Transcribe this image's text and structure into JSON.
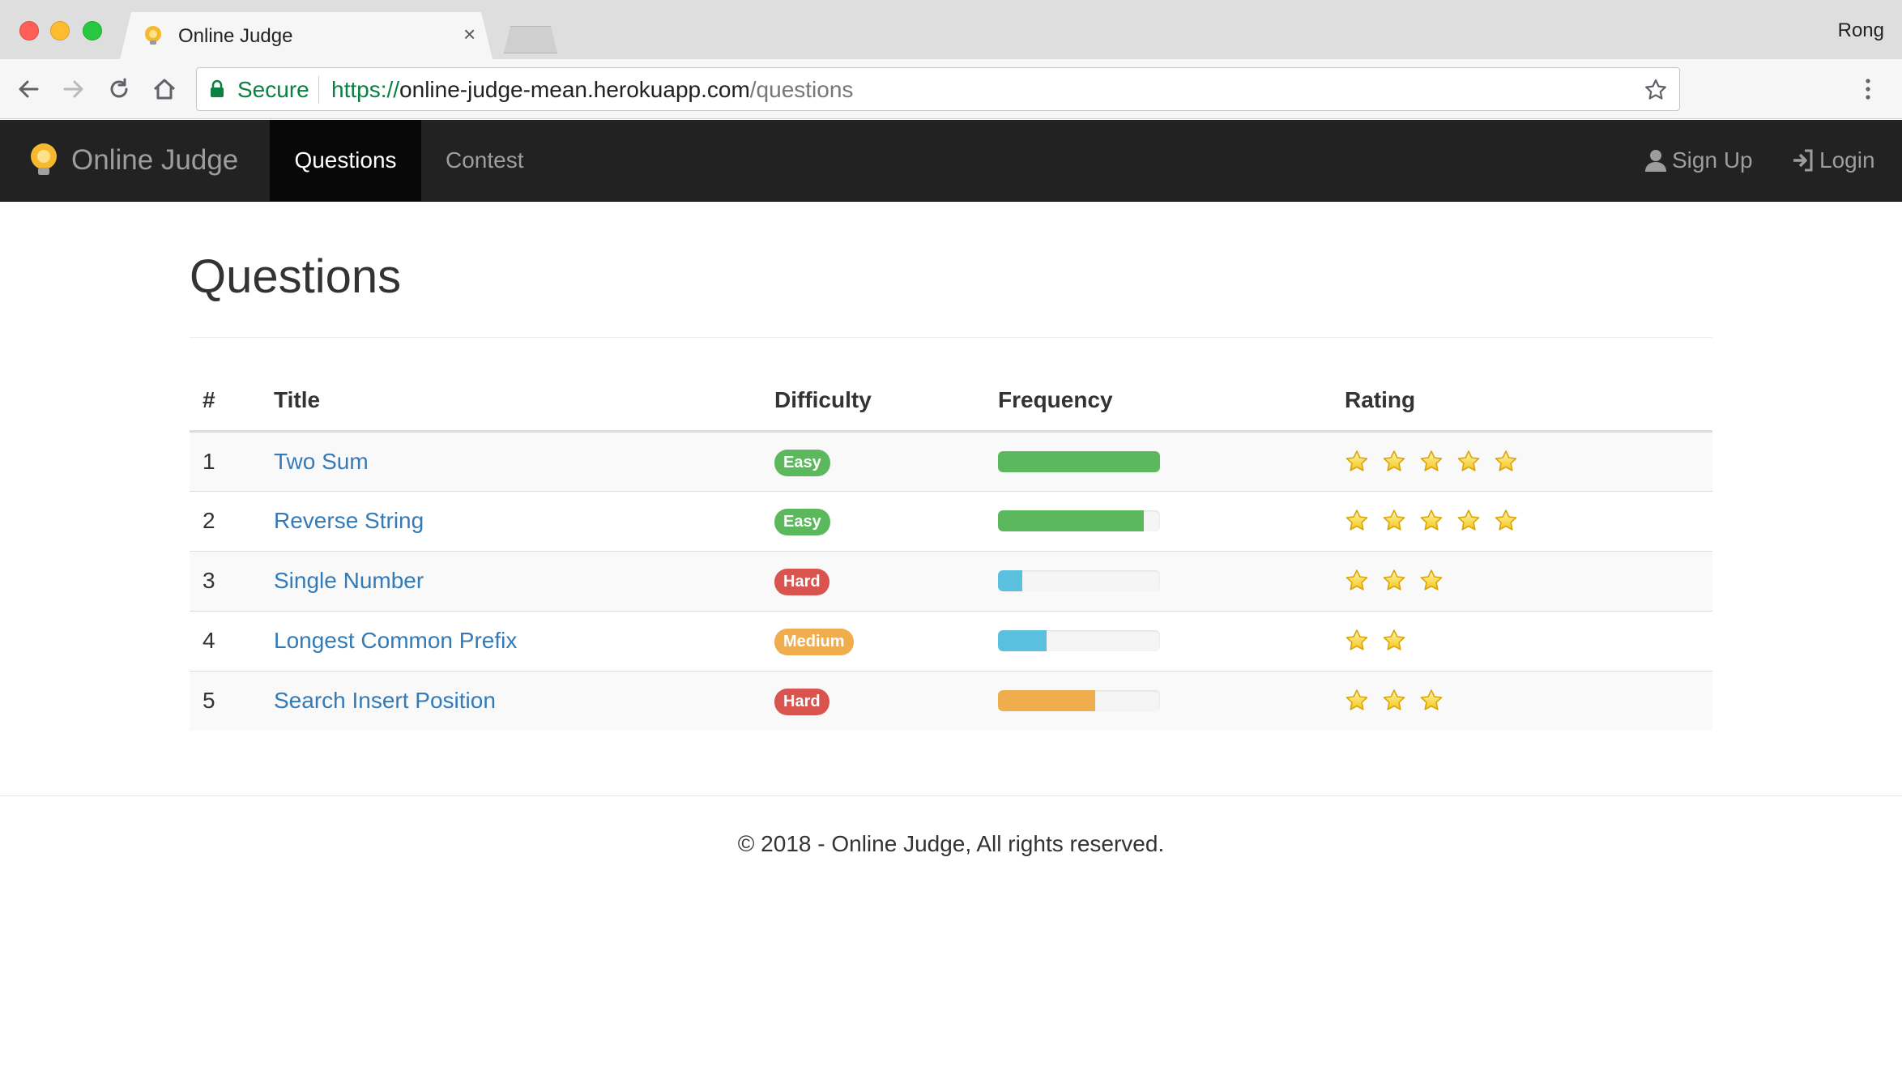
{
  "browser": {
    "tab_title": "Online Judge",
    "tab_close": "×",
    "profile_name": "Rong",
    "secure_label": "Secure",
    "url_scheme": "https://",
    "url_host": "online-judge-mean.herokuapp.com",
    "url_path": "/questions",
    "icons": [
      "back-icon",
      "forward-icon",
      "reload-icon",
      "home-icon",
      "lock-icon",
      "bookmark-star-icon",
      "menu-icon"
    ]
  },
  "navbar": {
    "brand": "Online Judge",
    "items": [
      {
        "label": "Questions",
        "active": true
      },
      {
        "label": "Contest",
        "active": false
      }
    ],
    "right": [
      {
        "label": "Sign Up",
        "icon": "user-icon"
      },
      {
        "label": "Login",
        "icon": "login-icon"
      }
    ]
  },
  "page": {
    "title": "Questions"
  },
  "table": {
    "headers": [
      "#",
      "Title",
      "Difficulty",
      "Frequency",
      "Rating"
    ],
    "rows": [
      {
        "num": "1",
        "title": "Two Sum",
        "difficulty": "Easy",
        "frequency": 100,
        "rating": 5
      },
      {
        "num": "2",
        "title": "Reverse String",
        "difficulty": "Easy",
        "frequency": 90,
        "rating": 5
      },
      {
        "num": "3",
        "title": "Single Number",
        "difficulty": "Hard",
        "frequency": 15,
        "rating": 3
      },
      {
        "num": "4",
        "title": "Longest Common Prefix",
        "difficulty": "Medium",
        "frequency": 30,
        "rating": 2
      },
      {
        "num": "5",
        "title": "Search Insert Position",
        "difficulty": "Hard",
        "frequency": 60,
        "rating": 3
      }
    ]
  },
  "colors": {
    "easy": "#5cb85c",
    "hard": "#d9534f",
    "medium": "#f0ad4e",
    "freq_high": "#5cb85c",
    "freq_low": "#5bc0de",
    "freq_mid": "#f0ad4e",
    "link": "#337ab7",
    "navbar": "#222222"
  },
  "footer": {
    "text": "© 2018 - Online Judge, All rights reserved."
  }
}
